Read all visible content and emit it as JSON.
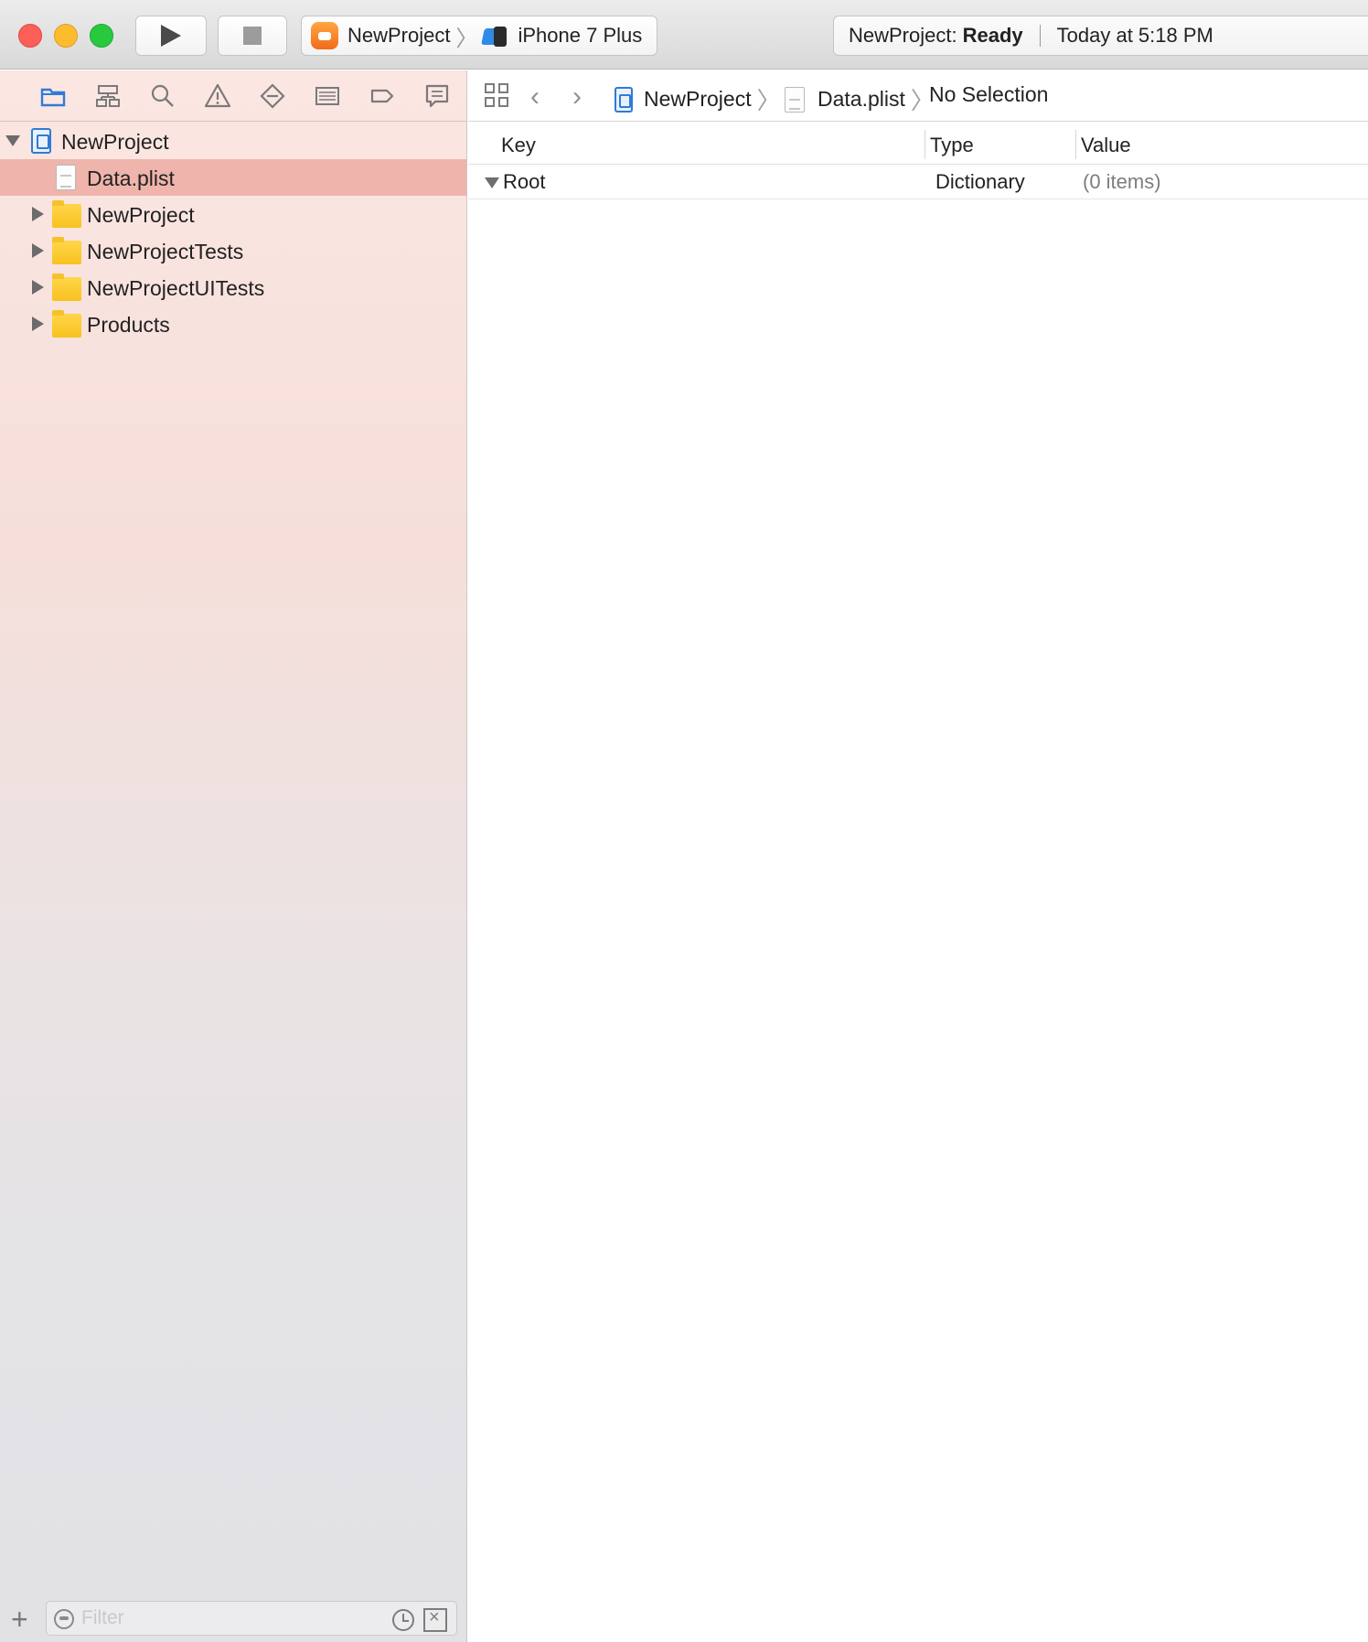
{
  "toolbar": {
    "run_icon": "play-icon",
    "stop_icon": "stop-icon",
    "scheme": {
      "project": "NewProject",
      "device": "iPhone 7 Plus"
    },
    "activity": {
      "project_prefix": "NewProject:",
      "status": "Ready",
      "timestamp": "Today at 5:18 PM"
    }
  },
  "navigator": {
    "tabs": [
      "folder-icon",
      "hierarchy-icon",
      "search-icon",
      "warning-icon",
      "test-diamond-icon",
      "debug-list-icon",
      "breakpoint-icon",
      "report-icon"
    ],
    "tree": {
      "root": "NewProject",
      "items": [
        {
          "label": "Data.plist",
          "kind": "file",
          "selected": true
        },
        {
          "label": "NewProject",
          "kind": "folder"
        },
        {
          "label": "NewProjectTests",
          "kind": "folder"
        },
        {
          "label": "NewProjectUITests",
          "kind": "folder"
        },
        {
          "label": "Products",
          "kind": "folder"
        }
      ]
    },
    "filter": {
      "placeholder": "Filter"
    }
  },
  "jumpbar": {
    "project": "NewProject",
    "file": "Data.plist",
    "selection": "No Selection"
  },
  "plist": {
    "columns": [
      "Key",
      "Type",
      "Value"
    ],
    "rows": [
      {
        "key": "Root",
        "type": "Dictionary",
        "value": "(0 items)"
      }
    ]
  },
  "colors": {
    "selection": "#efb4ab",
    "accent": "#2f7bd6",
    "folder": "#f8c21f"
  }
}
